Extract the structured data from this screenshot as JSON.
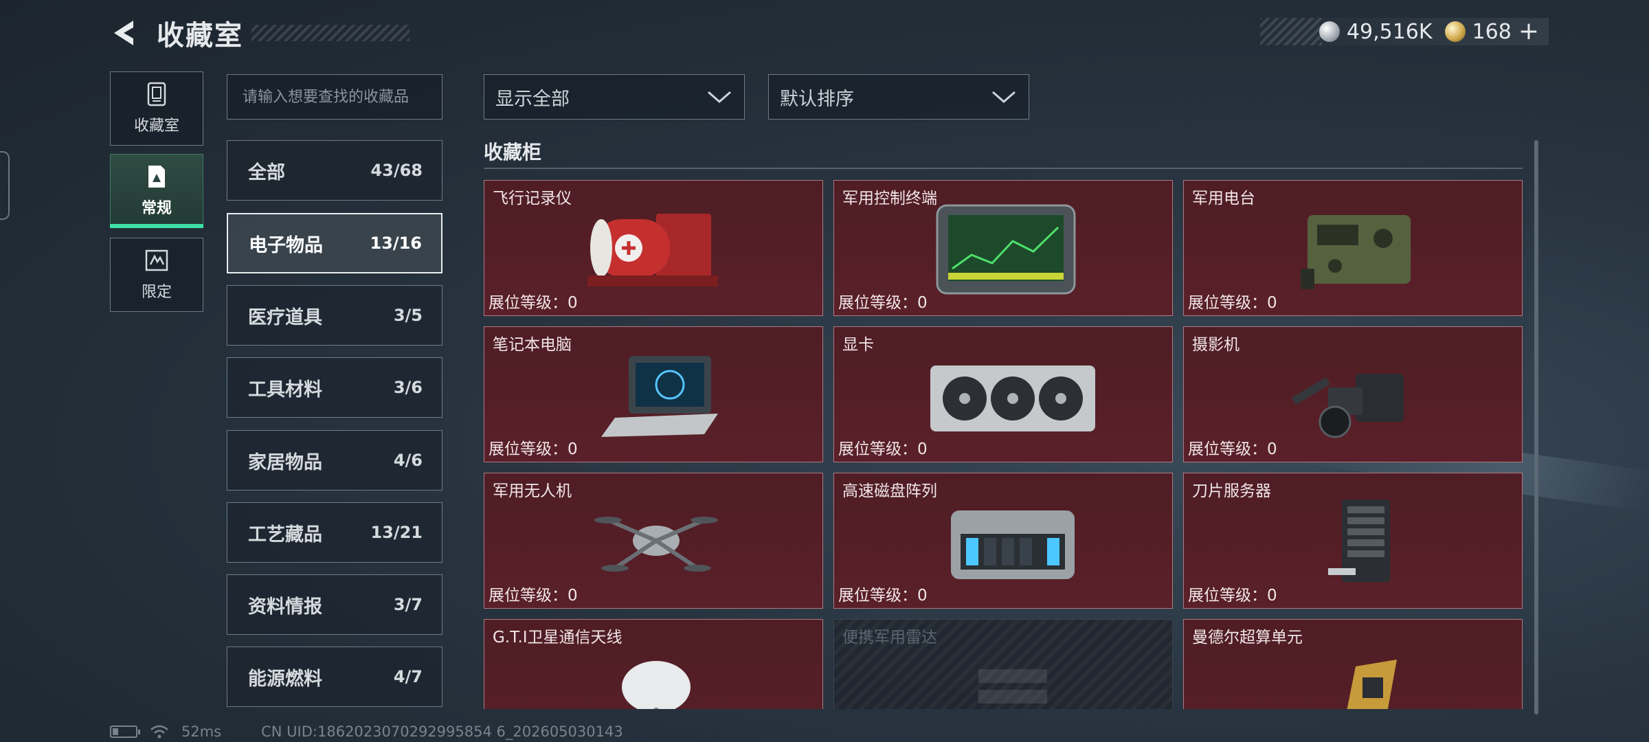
{
  "header": {
    "title": "收藏室"
  },
  "currency": [
    {
      "icon": "silver-coin-icon",
      "value": "49,516K"
    },
    {
      "icon": "gold-coin-icon",
      "value": "168"
    }
  ],
  "rail": [
    {
      "label": "收藏室",
      "icon": "collection-room-icon",
      "active": false
    },
    {
      "label": "常规",
      "icon": "regular-icon",
      "active": true
    },
    {
      "label": "限定",
      "icon": "limited-icon",
      "active": false
    }
  ],
  "search": {
    "placeholder": "请输入想要查找的收藏品"
  },
  "categories": [
    {
      "name": "全部",
      "count": "43/68",
      "active": false
    },
    {
      "name": "电子物品",
      "count": "13/16",
      "active": true
    },
    {
      "name": "医疗道具",
      "count": "3/5",
      "active": false
    },
    {
      "name": "工具材料",
      "count": "3/6",
      "active": false
    },
    {
      "name": "家居物品",
      "count": "4/6",
      "active": false
    },
    {
      "name": "工艺藏品",
      "count": "13/21",
      "active": false
    },
    {
      "name": "资料情报",
      "count": "3/7",
      "active": false
    },
    {
      "name": "能源燃料",
      "count": "4/7",
      "active": false
    }
  ],
  "filters": {
    "show": "显示全部",
    "sort": "默认排序"
  },
  "cabinet": {
    "title": "收藏柜",
    "level_label": "展位等级：",
    "items": [
      {
        "name": "飞行记录仪",
        "level": "0",
        "art": "flight-recorder-icon",
        "locked": false
      },
      {
        "name": "军用控制终端",
        "level": "0",
        "art": "military-terminal-icon",
        "locked": false
      },
      {
        "name": "军用电台",
        "level": "0",
        "art": "military-radio-icon",
        "locked": false
      },
      {
        "name": "笔记本电脑",
        "level": "0",
        "art": "laptop-icon",
        "locked": false
      },
      {
        "name": "显卡",
        "level": "0",
        "art": "graphics-card-icon",
        "locked": false
      },
      {
        "name": "摄影机",
        "level": "0",
        "art": "camera-icon",
        "locked": false
      },
      {
        "name": "军用无人机",
        "level": "0",
        "art": "drone-icon",
        "locked": false
      },
      {
        "name": "高速磁盘阵列",
        "level": "0",
        "art": "disk-array-icon",
        "locked": false
      },
      {
        "name": "刀片服务器",
        "level": "0",
        "art": "blade-server-icon",
        "locked": false
      },
      {
        "name": "G.T.I卫星通信天线",
        "level": "",
        "art": "satellite-dish-icon",
        "locked": false
      },
      {
        "name": "便携军用雷达",
        "level": "",
        "art": "portable-radar-icon",
        "locked": true
      },
      {
        "name": "曼德尔超算单元",
        "level": "",
        "art": "supercomputer-unit-icon",
        "locked": false
      }
    ]
  },
  "footer": {
    "ping": "52ms",
    "uid": "CN UID:1862023070292995854 6_202605030143"
  }
}
